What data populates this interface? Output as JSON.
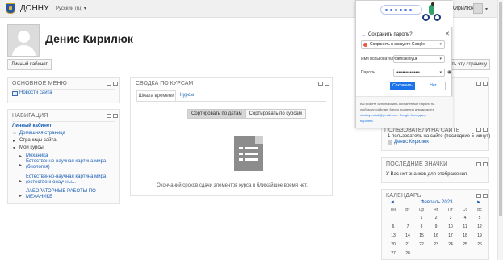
{
  "header": {
    "brand": "ДОННУ",
    "language": "Русский (ru) ▾",
    "user_short": "Кирилюк"
  },
  "page": {
    "title": "Денис Кирилюк",
    "profile_button": "Личный кабинет",
    "edit_button": "сть эту страницу"
  },
  "main_menu": {
    "title": "ОСНОВНОЕ МЕНЮ",
    "items": [
      {
        "label": "Новости сайта"
      }
    ]
  },
  "navigation": {
    "title": "НАВИГАЦИЯ",
    "dashboard": "Личный кабинет",
    "items": [
      {
        "label": "Домашняя страница"
      },
      {
        "label": "Страницы сайта"
      },
      {
        "label": "Мои курсы"
      }
    ],
    "courses": [
      {
        "label": "Механика"
      },
      {
        "label": "Естественно-научная картина мира"
      },
      {
        "label": "(биология)"
      },
      {
        "label": "Естественно-научная картина мира"
      },
      {
        "label": "(естественнонаучны..."
      },
      {
        "label": "ЛАБОРАТОРНЫЕ РАБОТЫ ПО"
      },
      {
        "label": "МЕХАНИКЕ"
      }
    ]
  },
  "course_overview": {
    "title": "СВОДКА ПО КУРСАМ",
    "tabs": [
      "Шкала времени",
      "Курсы"
    ],
    "sort_buttons": [
      "Сортировать по датам",
      "Сортировать по курсам"
    ],
    "empty_message": "Окончаний сроков сдачи элементов курса в ближайшее время нет."
  },
  "password_prompt": {
    "question": "Сохранить пароль?",
    "account_option": "Сохранить в аккаунте Google",
    "username_label": "Имя пользователя",
    "username_value": "deniskirilyuk",
    "password_label": "Пароль",
    "password_value": "•••••••••••••••••",
    "save_button": "Сохранить",
    "no_button": "Нет",
    "footer_lines": [
      "Вы можете использовать сохраненные пароли на",
      "любом устройстве. Место хранения для аккаунта",
      "nicolay.maluk@gmail.com: Google Менеджер",
      "паролей."
    ]
  },
  "online_users": {
    "title": "ПОЛЬЗОВАТЕЛИ НА САЙТЕ",
    "summary": "1 пользователь на сайте (последние 5 минут)",
    "users": [
      {
        "name": "Денис Кирилюк"
      }
    ]
  },
  "badges": {
    "title": "ПОСЛЕДНИЕ ЗНАЧКИ",
    "empty_message": "У Вас нет значков для отображения"
  },
  "calendar": {
    "title": "КАЛЕНДАРЬ",
    "prev": "◄",
    "next": "►",
    "month": "Февраль 2023",
    "weekdays": [
      "Пн",
      "Вт",
      "Ср",
      "Чт",
      "Пт",
      "Сб",
      "Вс"
    ],
    "weeks": [
      [
        "",
        "",
        "1",
        "2",
        "3",
        "4",
        "5"
      ],
      [
        "6",
        "7",
        "8",
        "9",
        "10",
        "11",
        "12"
      ],
      [
        "13",
        "14",
        "15",
        "16",
        "17",
        "18",
        "19"
      ],
      [
        "20",
        "21",
        "22",
        "23",
        "24",
        "25",
        "26"
      ],
      [
        "27",
        "28",
        "",
        "",
        "",
        "",
        ""
      ]
    ]
  },
  "colors": {
    "link": "#1a5fb4",
    "google_blue": "#1a73e8",
    "block_bg": "#fafafa"
  }
}
